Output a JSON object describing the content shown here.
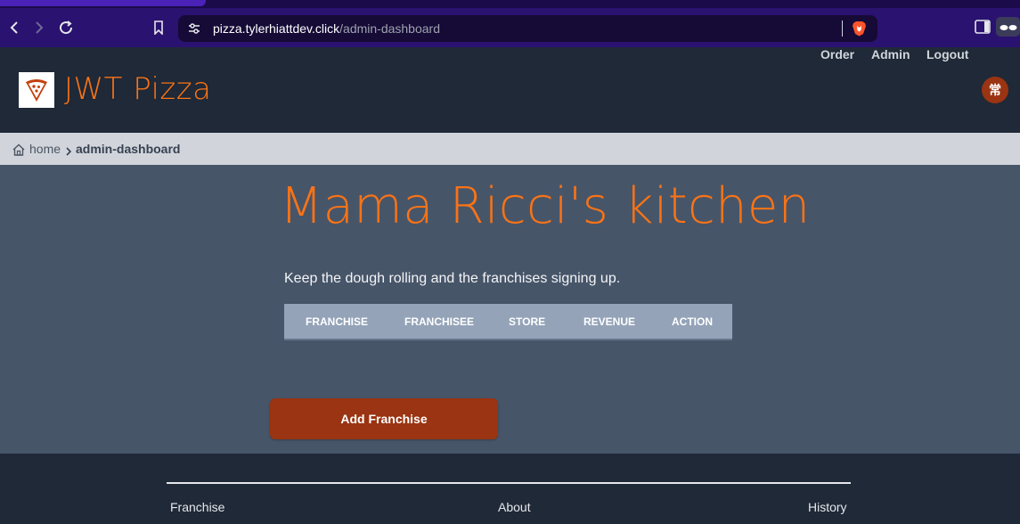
{
  "browser": {
    "url_host": "pizza.tylerhiattdev.click",
    "url_path": "/admin-dashboard"
  },
  "header": {
    "brand": "JWT Pizza",
    "nav": [
      "Order",
      "Admin",
      "Logout"
    ],
    "avatar_initials": "常"
  },
  "breadcrumb": {
    "home": "home",
    "current": "admin-dashboard"
  },
  "main": {
    "title": "Mama Ricci's kitchen",
    "subtitle": "Keep the dough rolling and the franchises signing up.",
    "table_headers": [
      "FRANCHISE",
      "FRANCHISEE",
      "STORE",
      "REVENUE",
      "ACTION"
    ],
    "add_button": "Add Franchise"
  },
  "footer": {
    "links": [
      "Franchise",
      "About",
      "History"
    ]
  },
  "colors": {
    "accent": "#f97316",
    "button": "#9a3412",
    "header_bg": "#1f2937",
    "main_bg": "#475569"
  }
}
